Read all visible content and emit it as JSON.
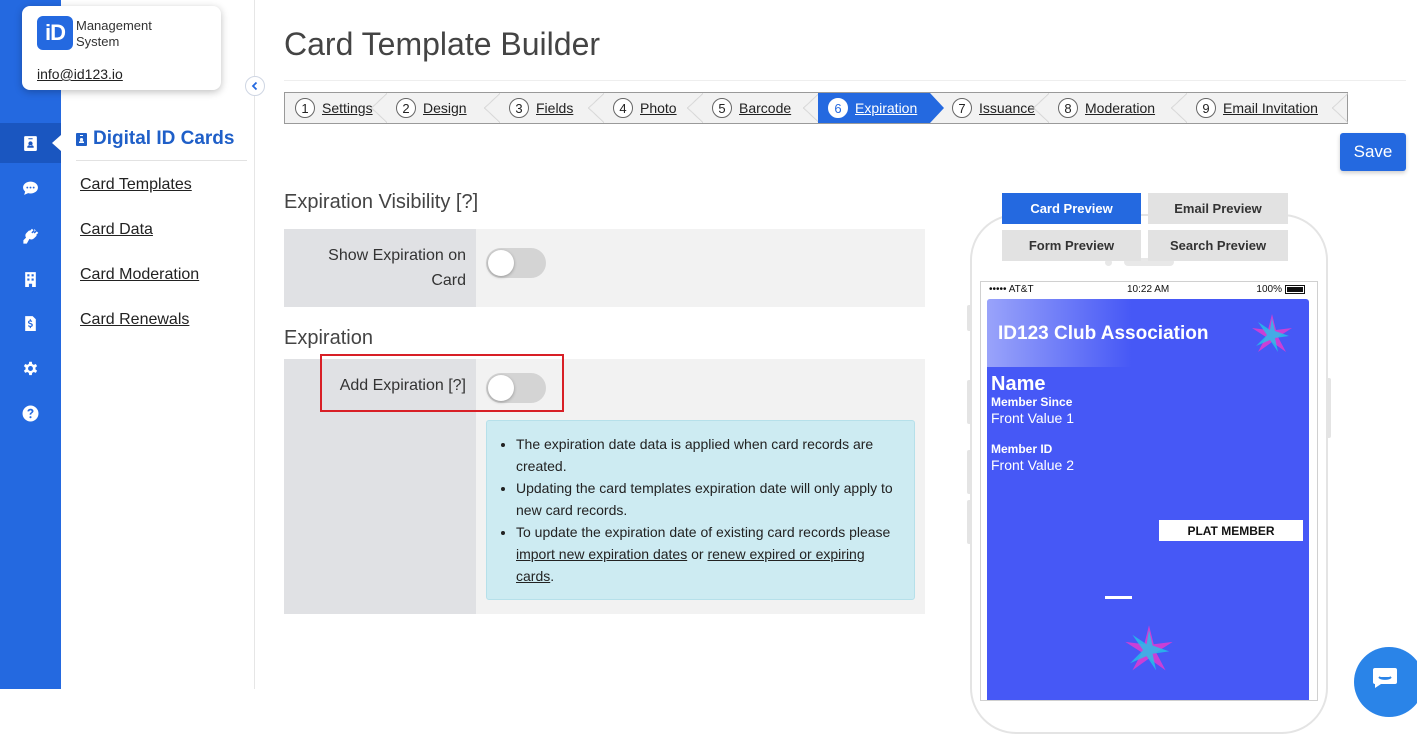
{
  "app": {
    "logo_mark": "iD",
    "logo_line1": "Management",
    "logo_line2": "System",
    "email": "info@id123.io"
  },
  "rail": {
    "icons": [
      "id-card-icon",
      "chat-icon",
      "plug-icon",
      "building-icon",
      "receipt-icon",
      "gear-icon",
      "help-icon"
    ],
    "active_index": 0
  },
  "subnav": {
    "title": "Digital ID Cards",
    "items": [
      "Card Templates",
      "Card Data",
      "Card Moderation",
      "Card Renewals"
    ]
  },
  "page": {
    "title": "Card Template Builder",
    "save_label": "Save"
  },
  "stepper": {
    "steps": [
      {
        "num": "1",
        "label": "Settings"
      },
      {
        "num": "2",
        "label": "Design"
      },
      {
        "num": "3",
        "label": "Fields"
      },
      {
        "num": "4",
        "label": "Photo"
      },
      {
        "num": "5",
        "label": "Barcode"
      },
      {
        "num": "6",
        "label": "Expiration"
      },
      {
        "num": "7",
        "label": "Issuance"
      },
      {
        "num": "8",
        "label": "Moderation"
      },
      {
        "num": "9",
        "label": "Email Invitation"
      }
    ],
    "active_step": "6"
  },
  "expiration_visibility": {
    "heading": "Expiration Visibility [?]",
    "show_label_line1": "Show Expiration on",
    "show_label_line2": "Card",
    "show_enabled": false
  },
  "expiration": {
    "heading": "Expiration",
    "add_label": "Add Expiration [?]",
    "add_enabled": false,
    "info": {
      "bullet1": "The expiration date data is applied when card records are created.",
      "bullet2": "Updating the card templates expiration date will only apply to new card records.",
      "bullet3_prefix": "To update the expiration date of existing card records please ",
      "bullet3_link1": "import new expiration dates",
      "bullet3_mid": " or ",
      "bullet3_link2": "renew expired or expiring cards",
      "bullet3_suffix": "."
    }
  },
  "preview": {
    "tabs": [
      "Card Preview",
      "Email Preview",
      "Form Preview",
      "Search Preview"
    ],
    "active_tab": "Card Preview",
    "status": {
      "carrier": "••••• AT&T",
      "time": "10:22 AM",
      "battery": "100%"
    },
    "card": {
      "org_name": "ID123 Club Association",
      "name": "Name",
      "field1_label": "Member Since",
      "field1_value": "Front Value 1",
      "field2_label": "Member ID",
      "field2_value": "Front Value 2",
      "tag": "PLAT MEMBER",
      "background_color": "#4658f6"
    }
  },
  "colors": {
    "primary": "#2469e0",
    "highlight_border": "#d81f26",
    "info_bg": "#cdebf2"
  }
}
